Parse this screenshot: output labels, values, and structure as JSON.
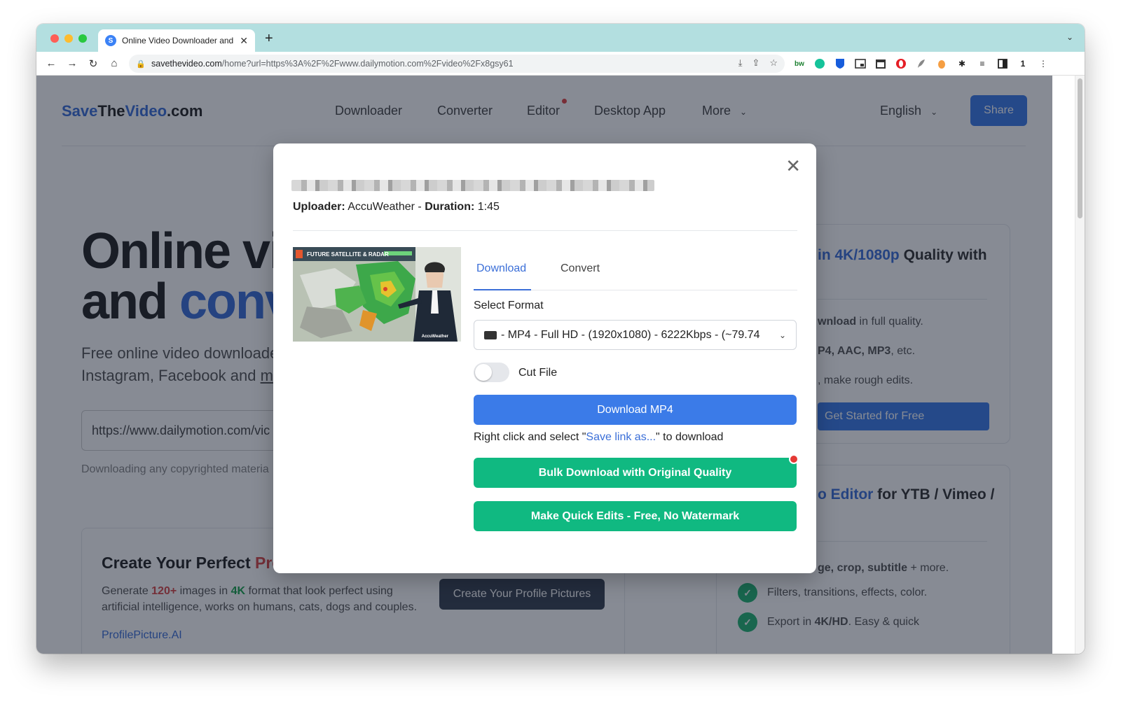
{
  "browser": {
    "tab_title": "Online Video Downloader and Converter",
    "favicon_letter": "S",
    "url_host": "savethevideo.com",
    "url_path": "/home?url=https%3A%2F%2Fwww.dailymotion.com%2Fvideo%2Fx8gsy61",
    "new_tab": "+",
    "tab_close": "✕",
    "tab_menu": "⌄"
  },
  "site": {
    "logo_save": "Save",
    "logo_the": "The",
    "logo_video": "Video",
    "logo_com": ".com",
    "nav": {
      "downloader": "Downloader",
      "converter": "Converter",
      "editor": "Editor",
      "desktop_app": "Desktop App",
      "more": "More"
    },
    "language": "English",
    "share": "Share",
    "hero_line1": "Online vi",
    "hero_line2_a": "and ",
    "hero_line2_b": "conv",
    "sub_line1": "Free online video downloade",
    "sub_line2_a": "Instagram, Facebook and ",
    "sub_line2_b": "m",
    "url_input_value": "https://www.dailymotion.com/vic",
    "notice": "Downloading any copyrighted materia",
    "profile_card": {
      "title_a": "Create Your Perfect ",
      "title_b": "Pro",
      "text_a": "Generate ",
      "text_count": "120+",
      "text_b": " images in ",
      "text_4k": "4K",
      "text_c": " format that look perfect using artificial intelligence, works on humans, cats, dogs and couples.",
      "button": "Create Your Profile Pictures",
      "link": "ProfilePicture.AI"
    },
    "right_card1": {
      "title_blue": "in 4K/1080p",
      "title_rest": " Quality with",
      "line1_b": "wnload",
      "line1_rest": " in full quality.",
      "line2_b": "P4, AAC, MP3",
      "line2_rest": ", etc.",
      "line3": ", make rough edits.",
      "button": "Get Started for Free"
    },
    "right_card2": {
      "title_blue": "o Editor",
      "title_rest": " for YTB / Vimeo /",
      "partial_b": "ge, crop, subtitle",
      "partial_rest": " + more.",
      "item1": "Filters, transitions, effects, color.",
      "item2_a": "Export in ",
      "item2_b": "4K/HD",
      "item2_c": ". Easy & quick"
    }
  },
  "modal": {
    "close": "✕",
    "uploader_label": "Uploader:",
    "uploader": "AccuWeather",
    "sep": " - ",
    "duration_label": "Duration:",
    "duration": "1:45",
    "thumb_banner": "FUTURE SATELLITE & RADAR",
    "thumb_brand": "AccuWeather",
    "tabs": [
      "Download",
      "Convert"
    ],
    "active_tab": "Download",
    "select_label": "Select Format",
    "format_value": " - MP4 - Full HD - (1920x1080) - 6222Kbps - (~79.74",
    "cut_label": "Cut File",
    "cut_enabled": false,
    "download_button": "Download MP4",
    "hint_a": "Right click and select \"",
    "hint_link": "Save link as...",
    "hint_b": "\" to download",
    "bulk_button": "Bulk Download with Original Quality",
    "edit_button": "Make Quick Edits - Free, No Watermark"
  },
  "colors": {
    "primary": "#3b7be8",
    "green": "#10b981",
    "link": "#3b6fd8"
  }
}
